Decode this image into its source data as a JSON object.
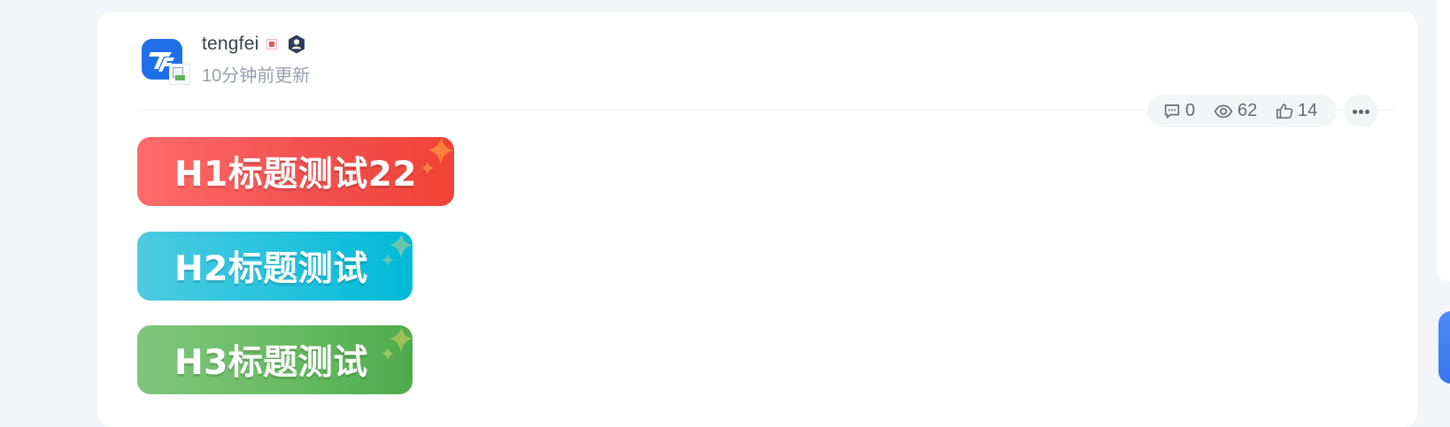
{
  "post": {
    "author": {
      "name": "tengfei",
      "avatar_icon": "tf-logo-icon",
      "verified_icon": "verified-user-icon"
    },
    "time": "10分钟前更新",
    "stats": {
      "comments": "0",
      "views": "62",
      "likes": "14"
    },
    "headings": [
      {
        "label": "H1标题测试22",
        "color_start": "#ff6b6b",
        "color_end": "#ef4335"
      },
      {
        "label": "H2标题测试",
        "color_start": "#4ccbe0",
        "color_end": "#00bad6"
      },
      {
        "label": "H3标题测试",
        "color_start": "#80c67d",
        "color_end": "#4eab4b"
      }
    ]
  },
  "colors": {
    "page_bg": "#f3f5f8",
    "card_bg": "#ffffff",
    "brand_blue": "#1f6fe8",
    "stat_bg": "#f4f5f7"
  },
  "icons": {
    "comment": "comment-icon",
    "views": "eye-icon",
    "likes": "thumbs-up-icon",
    "more": "more-horizontal-icon"
  }
}
